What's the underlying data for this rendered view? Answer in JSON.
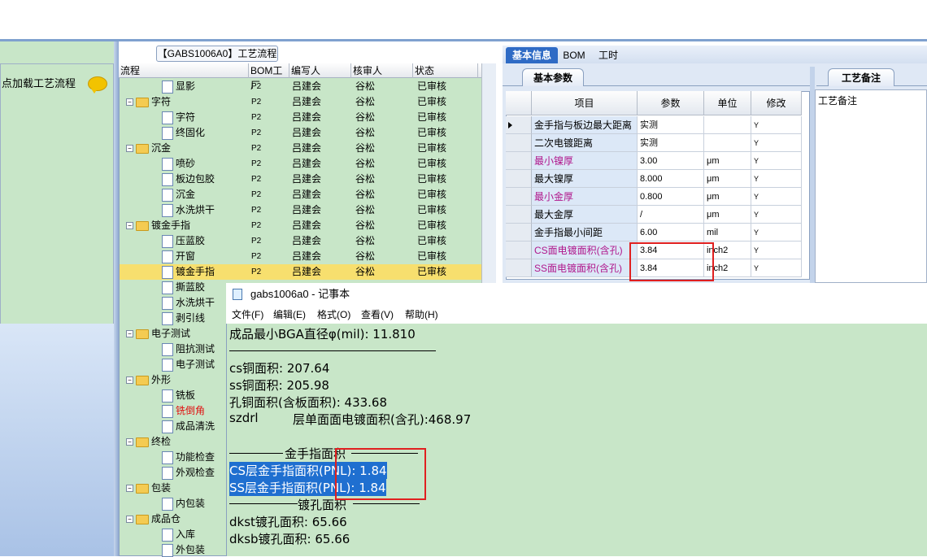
{
  "left_panel": {
    "load_label": "点加载工艺流程"
  },
  "process": {
    "title": "【GABS1006A0】工艺流程",
    "columns": [
      "流程",
      "BOM工厂",
      "编写人",
      "核审人",
      "状态"
    ],
    "rows": [
      {
        "name": "显影",
        "type": "file",
        "level": 2,
        "factory": "P2",
        "writer": "吕建会",
        "reviewer": "谷松",
        "status": "已审核"
      },
      {
        "name": "字符",
        "type": "folder",
        "level": 1,
        "factory": "P2",
        "writer": "吕建会",
        "reviewer": "谷松",
        "status": "已审核"
      },
      {
        "name": "字符",
        "type": "file",
        "level": 2,
        "factory": "P2",
        "writer": "吕建会",
        "reviewer": "谷松",
        "status": "已审核"
      },
      {
        "name": "终固化",
        "type": "file",
        "level": 2,
        "factory": "P2",
        "writer": "吕建会",
        "reviewer": "谷松",
        "status": "已审核"
      },
      {
        "name": "沉金",
        "type": "folder",
        "level": 1,
        "factory": "P2",
        "writer": "吕建会",
        "reviewer": "谷松",
        "status": "已审核"
      },
      {
        "name": "喷砂",
        "type": "file",
        "level": 2,
        "factory": "P2",
        "writer": "吕建会",
        "reviewer": "谷松",
        "status": "已审核"
      },
      {
        "name": "板边包胶",
        "type": "file",
        "level": 2,
        "factory": "P2",
        "writer": "吕建会",
        "reviewer": "谷松",
        "status": "已审核"
      },
      {
        "name": "沉金",
        "type": "file",
        "level": 2,
        "factory": "P2",
        "writer": "吕建会",
        "reviewer": "谷松",
        "status": "已审核"
      },
      {
        "name": "水洗烘干",
        "type": "file",
        "level": 2,
        "factory": "P2",
        "writer": "吕建会",
        "reviewer": "谷松",
        "status": "已审核"
      },
      {
        "name": "镀金手指",
        "type": "folder",
        "level": 1,
        "factory": "P2",
        "writer": "吕建会",
        "reviewer": "谷松",
        "status": "已审核"
      },
      {
        "name": "压蓝胶",
        "type": "file",
        "level": 2,
        "factory": "P2",
        "writer": "吕建会",
        "reviewer": "谷松",
        "status": "已审核"
      },
      {
        "name": "开窗",
        "type": "file",
        "level": 2,
        "factory": "P2",
        "writer": "吕建会",
        "reviewer": "谷松",
        "status": "已审核"
      },
      {
        "name": "镀金手指",
        "type": "file",
        "level": 2,
        "factory": "P2",
        "writer": "吕建会",
        "reviewer": "谷松",
        "status": "已审核",
        "selected": true
      },
      {
        "name": "撕蓝胶",
        "type": "file",
        "level": 2
      },
      {
        "name": "水洗烘干",
        "type": "file",
        "level": 2
      },
      {
        "name": "剥引线",
        "type": "file",
        "level": 2
      },
      {
        "name": "电子测试",
        "type": "folder",
        "level": 1
      },
      {
        "name": "阻抗测试",
        "type": "file",
        "level": 2
      },
      {
        "name": "电子测试",
        "type": "file",
        "level": 2
      },
      {
        "name": "外形",
        "type": "folder",
        "level": 1
      },
      {
        "name": "铣板",
        "type": "file",
        "level": 2
      },
      {
        "name": "铣倒角",
        "type": "file",
        "level": 2,
        "red": true
      },
      {
        "name": "成品清洗",
        "type": "file",
        "level": 2
      },
      {
        "name": "终检",
        "type": "folder",
        "level": 1
      },
      {
        "name": "功能检查",
        "type": "file",
        "level": 2
      },
      {
        "name": "外观检查",
        "type": "file",
        "level": 2
      },
      {
        "name": "包装",
        "type": "folder",
        "level": 1
      },
      {
        "name": "内包装",
        "type": "file",
        "level": 2
      },
      {
        "name": "成品仓",
        "type": "folder",
        "level": 1
      },
      {
        "name": "入库",
        "type": "file",
        "level": 2
      },
      {
        "name": "外包装",
        "type": "file",
        "level": 2
      }
    ]
  },
  "info": {
    "tabs": [
      "基本信息",
      "BOM",
      "工时"
    ],
    "subtab": "基本参数",
    "craft_tab": "工艺备注",
    "craft_label": "工艺备注",
    "columns": [
      "项目",
      "参数",
      "单位",
      "修改"
    ],
    "rows": [
      {
        "item": "金手指与板边最大距离",
        "param": "实测",
        "unit": "",
        "mod": "Y",
        "current": true
      },
      {
        "item": "二次电镀距离",
        "param": "实测",
        "unit": "",
        "mod": "Y"
      },
      {
        "item": "最小镍厚",
        "param": "3.00",
        "unit": "μm",
        "mod": "Y",
        "color": "#b0178c"
      },
      {
        "item": "最大镍厚",
        "param": "8.000",
        "unit": "μm",
        "mod": "Y"
      },
      {
        "item": "最小金厚",
        "param": "0.800",
        "unit": "μm",
        "mod": "Y",
        "color": "#b0178c"
      },
      {
        "item": "最大金厚",
        "param": "/",
        "unit": "μm",
        "mod": "Y"
      },
      {
        "item": "金手指最小间距",
        "param": "6.00",
        "unit": "mil",
        "mod": "Y"
      },
      {
        "item": "CS面电镀面积(含孔)",
        "param": "3.84",
        "unit": "inch2",
        "mod": "Y",
        "color": "#b0178c"
      },
      {
        "item": "SS面电镀面积(含孔)",
        "param": "3.84",
        "unit": "inch2",
        "mod": "Y",
        "color": "#b0178c"
      }
    ]
  },
  "notepad": {
    "title": "gabs1006a0 - 记事本",
    "menu": [
      "文件(F)",
      "编辑(E)",
      "格式(O)",
      "查看(V)",
      "帮助(H)"
    ],
    "lines": {
      "l1": "成品最小BGA直径φ(mil):  11.810",
      "l2": "cs铜面积: 207.64",
      "l3": "ss铜面积: 205.98",
      "l4": "孔铜面积(含板面积): 433.68",
      "l5a": "szdrl",
      "l5b": "层单面面电镀面积(含孔):468.97",
      "sec1": "金手指面积",
      "l6": "CS层金手指面积(PNL): 1.84",
      "l7": "SS层金手指面积(PNL): 1.84",
      "sec2": "镀孔面积",
      "l8": "dkst镀孔面积: 65.66",
      "l9": "dksb镀孔面积: 65.66"
    }
  }
}
